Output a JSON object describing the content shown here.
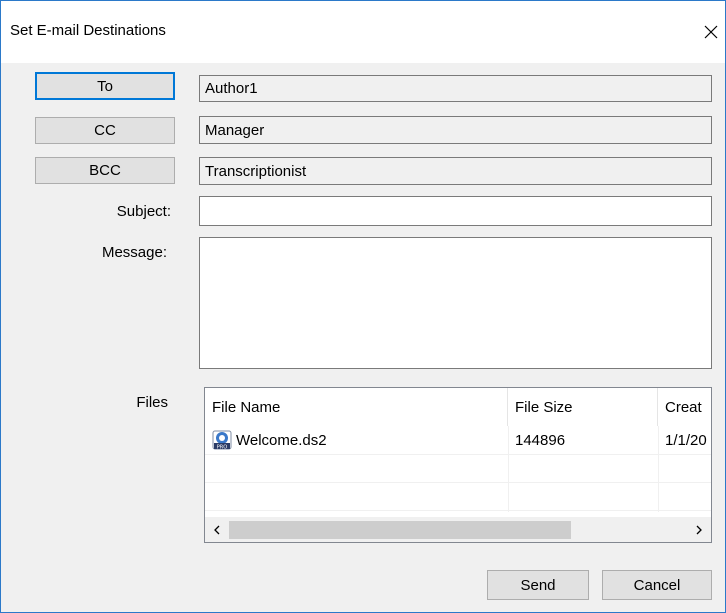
{
  "window": {
    "title": "Set E-mail Destinations"
  },
  "recipients": {
    "to": {
      "button_label": "To",
      "value": "Author1"
    },
    "cc": {
      "button_label": "CC",
      "value": "Manager"
    },
    "bcc": {
      "button_label": "BCC",
      "value": "Transcriptionist"
    }
  },
  "form": {
    "subject_label": "Subject:",
    "subject_value": "",
    "message_label": "Message:",
    "message_value": "",
    "files_label": "Files"
  },
  "files_table": {
    "columns": [
      "File Name",
      "File Size",
      "Creat"
    ],
    "rows": [
      {
        "name": "Welcome.ds2",
        "size": "144896",
        "created": "1/1/20",
        "icon": "dss-pro-file-icon"
      }
    ]
  },
  "scrollbar": {
    "left_arrow": "‹",
    "right_arrow": "›"
  },
  "actions": {
    "send_label": "Send",
    "cancel_label": "Cancel"
  },
  "colors": {
    "accent": "#0078d7",
    "border": "#2b79c9"
  }
}
